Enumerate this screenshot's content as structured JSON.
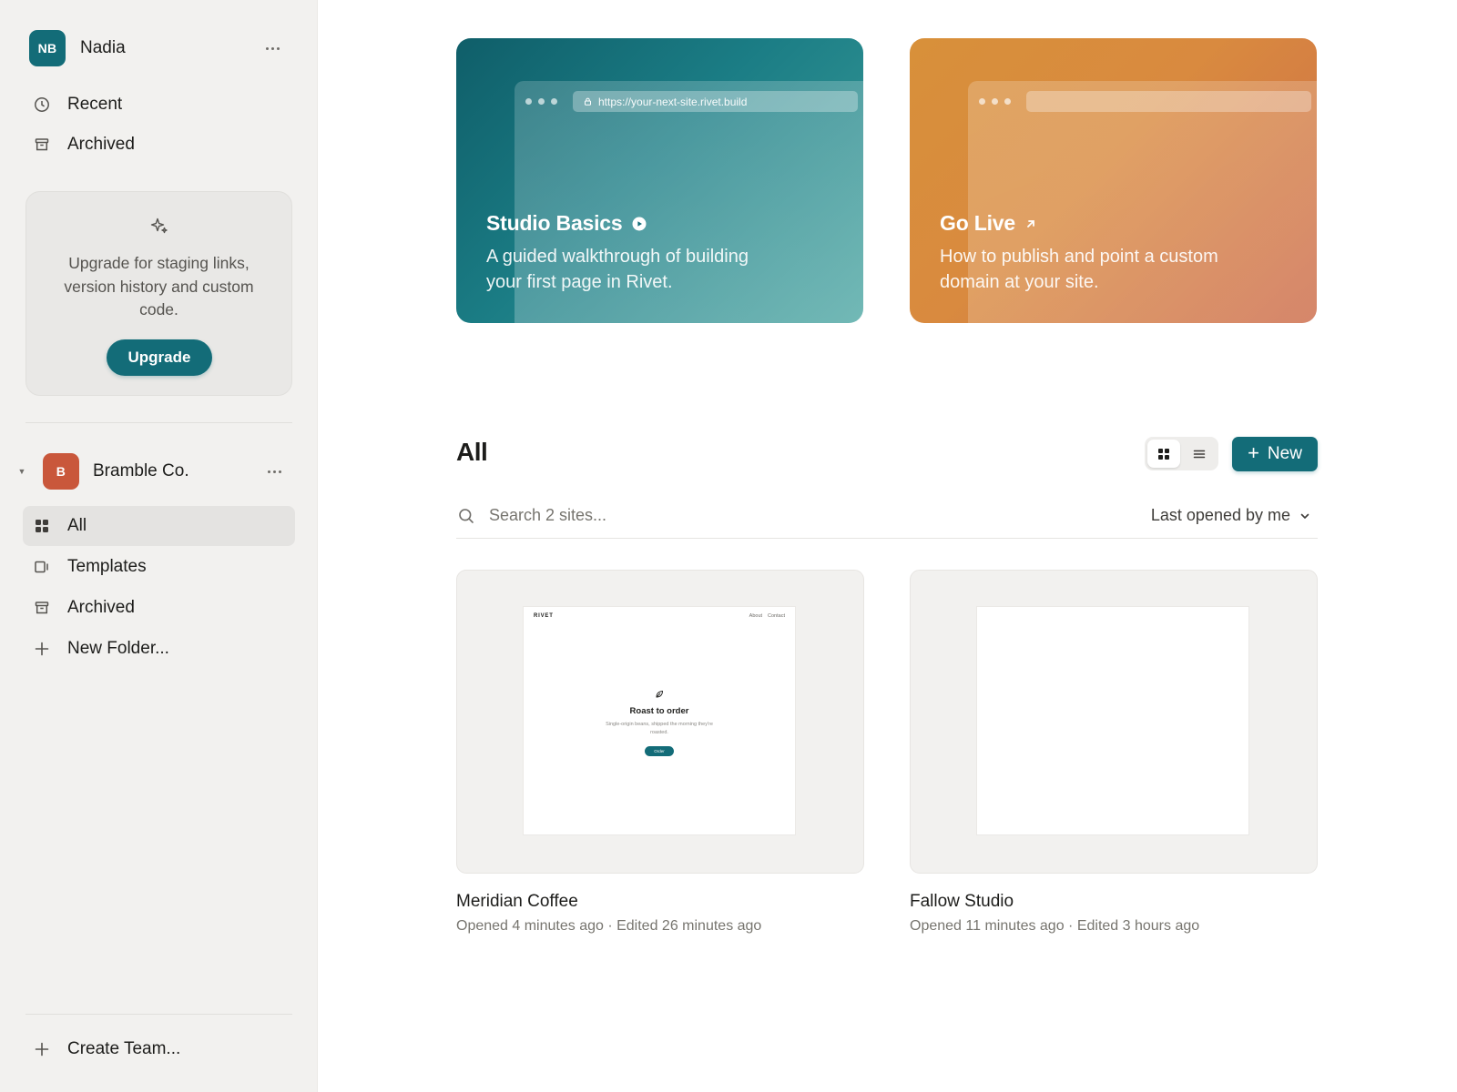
{
  "user": {
    "initials": "NB",
    "name": "Nadia"
  },
  "personal_nav": [
    {
      "label": "Recent",
      "icon": "clock-icon"
    },
    {
      "label": "Archived",
      "icon": "archive-icon"
    }
  ],
  "upgrade": {
    "text": "Upgrade for staging links, version history and custom code.",
    "button": "Upgrade"
  },
  "team": {
    "initial": "B",
    "name": "Bramble Co."
  },
  "team_nav": [
    {
      "label": "All",
      "icon": "grid-icon",
      "active": true
    },
    {
      "label": "Templates",
      "icon": "templates-icon"
    },
    {
      "label": "Archived",
      "icon": "archive-icon"
    },
    {
      "label": "New Folder...",
      "icon": "plus-icon"
    }
  ],
  "create_team": "Create Team...",
  "colors": {
    "accent": "#136c78",
    "team_avatar": "#c9573b",
    "sidebar_bg": "#f2f1ef"
  },
  "heroes": [
    {
      "title": "Studio Basics",
      "icon": "play-circle-icon",
      "url": "https://your-next-site.rivet.build",
      "description": "A guided walkthrough of building your first page in Rivet."
    },
    {
      "title": "Go Live",
      "icon": "arrow-up-right-icon",
      "url": "",
      "description": "How to publish and point a custom domain at your site."
    }
  ],
  "main": {
    "title": "All",
    "new_button": "New",
    "search_placeholder": "Search 2 sites...",
    "sort_label": "Last opened by me"
  },
  "sites": [
    {
      "name": "Meridian Coffee",
      "meta": "Opened 4 minutes ago · Edited 26 minutes ago",
      "preview": {
        "logo": "RIVET",
        "nav": [
          "About",
          "Contact"
        ],
        "heading": "Roast to order",
        "subtext": "Single-origin beans, shipped the morning they're roasted.",
        "button": "Order"
      }
    },
    {
      "name": "Fallow Studio",
      "meta": "Opened 11 minutes ago · Edited 3 hours ago"
    }
  ]
}
